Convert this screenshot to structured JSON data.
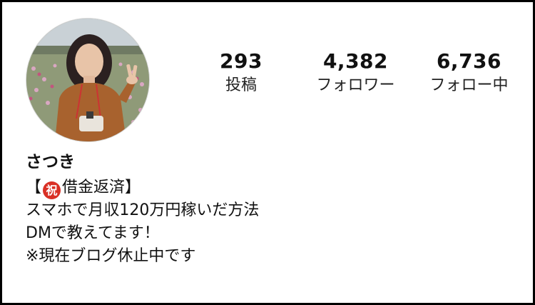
{
  "profile": {
    "avatar_icon": "profile-photo",
    "stats": {
      "posts": {
        "value": "293",
        "label": "投稿"
      },
      "followers": {
        "value": "4,382",
        "label": "フォロワー"
      },
      "following": {
        "value": "6,736",
        "label": "フォロー中"
      }
    },
    "name": "さつき",
    "bio": {
      "line1_open": "【",
      "line1_emoji": "祝",
      "line1_rest": "借金返済】",
      "line2": "スマホで月収120万円稼いだ方法",
      "line3": "DMで教えてます！",
      "line4": "※現在ブログ休止中です"
    }
  },
  "colors": {
    "border": "#000000",
    "celebrate_badge": "#d93025"
  }
}
